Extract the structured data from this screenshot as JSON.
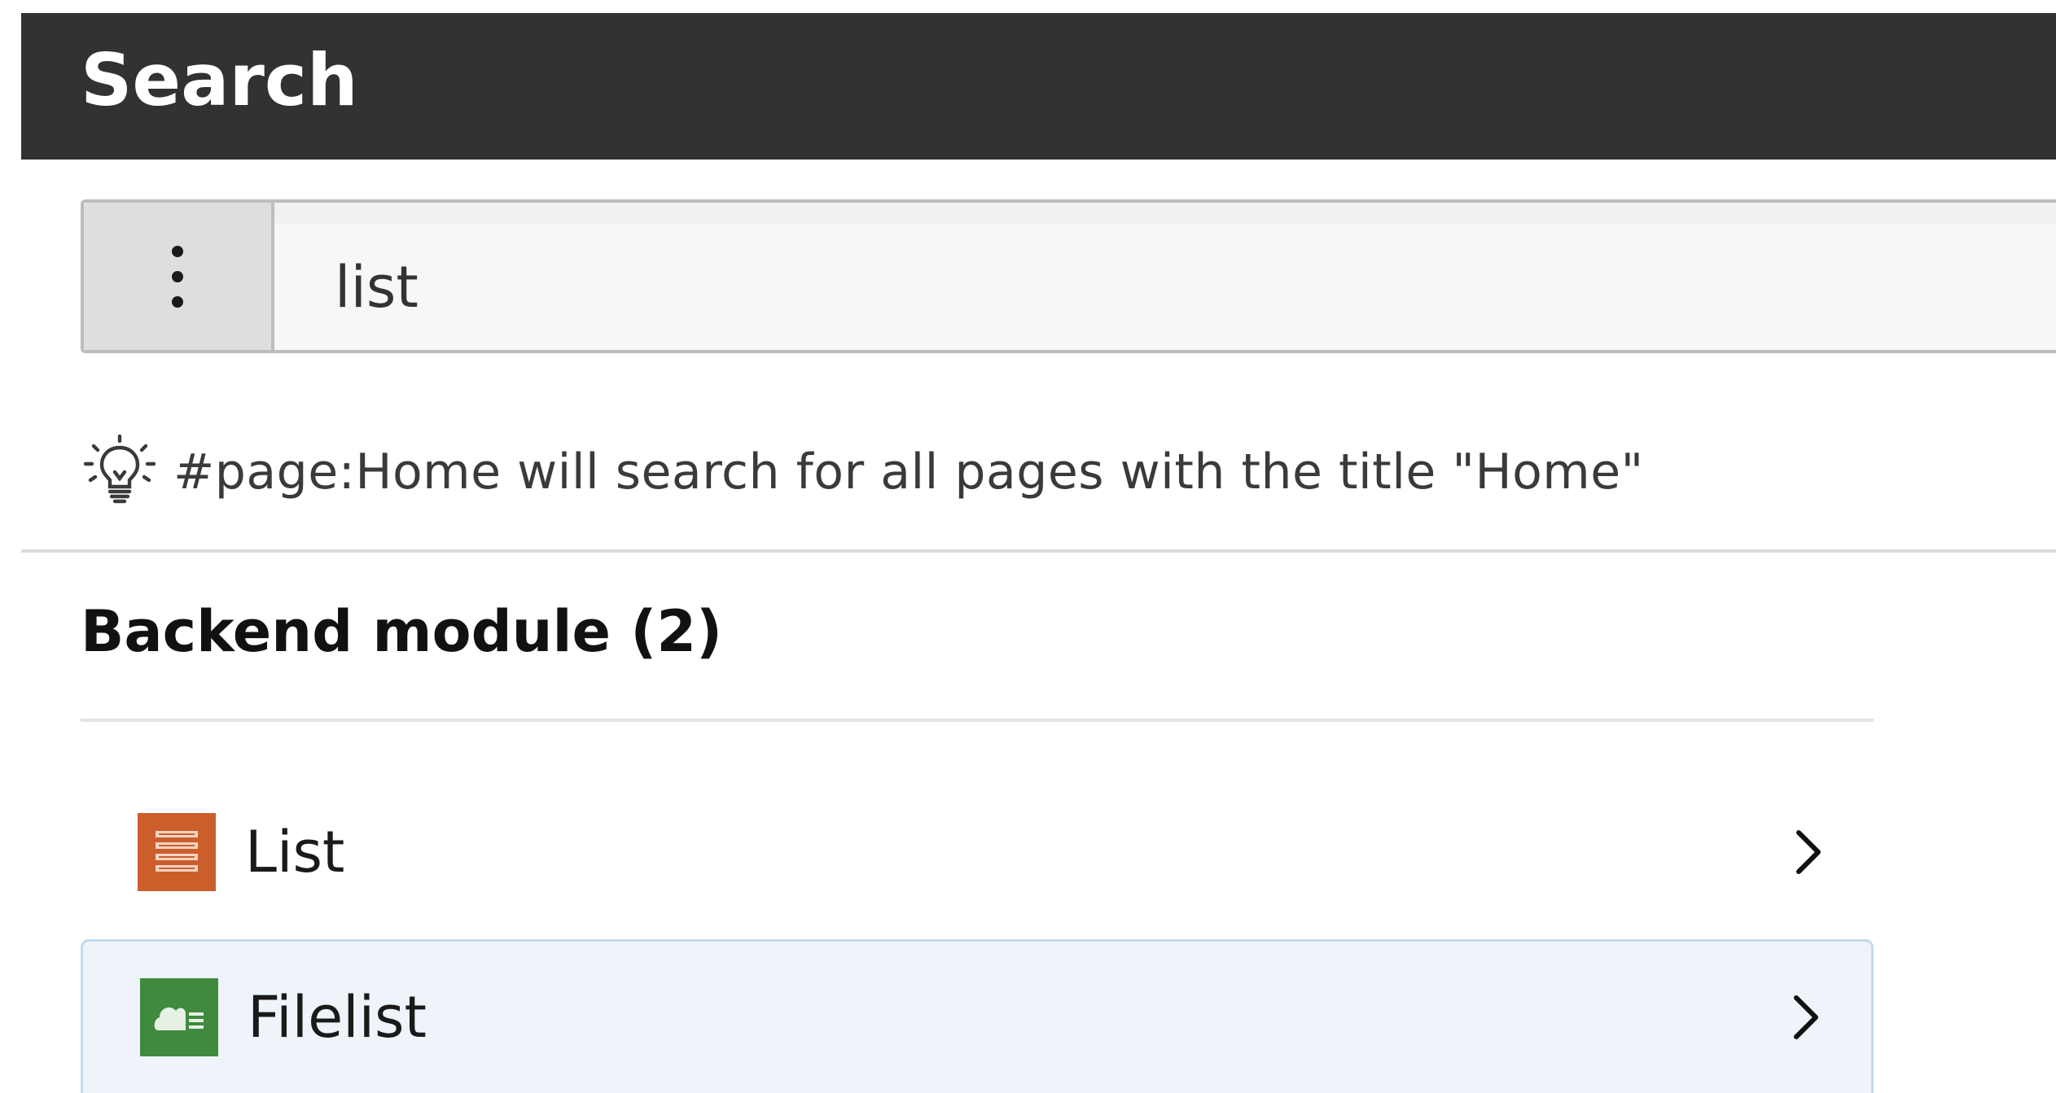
{
  "header": {
    "title": "Search"
  },
  "search": {
    "value": "list",
    "options_icon": "kebab-vertical-icon"
  },
  "hint": {
    "icon": "lightbulb-icon",
    "text": "#page:Home will search for all pages with the title \"Home\""
  },
  "section": {
    "heading": "Backend module (2)",
    "items": [
      {
        "label": "List",
        "icon": "list-module-icon",
        "icon_color": "#cc5e2c"
      },
      {
        "label": "Filelist",
        "icon": "filelist-module-icon",
        "icon_color": "#3f8a3e"
      }
    ]
  },
  "colors": {
    "header_bg": "#323232",
    "highlight_bg": "#eef4fa"
  }
}
